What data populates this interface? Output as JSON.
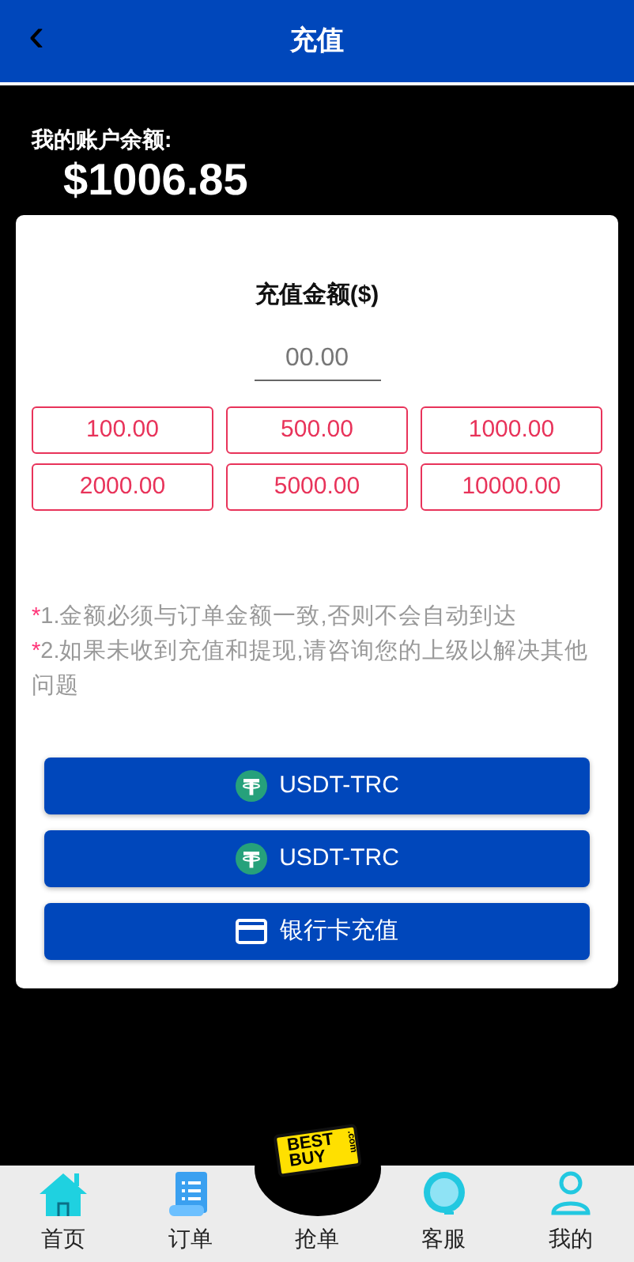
{
  "header": {
    "back": "‹",
    "title": "充值"
  },
  "balance": {
    "label": "我的账户余额:",
    "amount": "$1006.85"
  },
  "recharge": {
    "title": "充值金额($)",
    "amount_field": {
      "placeholder": "00.00"
    },
    "presets": [
      "100.00",
      "500.00",
      "1000.00",
      "2000.00",
      "5000.00",
      "10000.00"
    ],
    "notes": [
      {
        "mark": "*",
        "text": "1.金额必须与订单金额一致,否则不会自动到达"
      },
      {
        "mark": "*",
        "text": "2.如果未收到充值和提现,请咨询您的上级以解决其他问题"
      }
    ],
    "methods": [
      {
        "kind": "usdt",
        "label": "USDT-TRC"
      },
      {
        "kind": "usdt",
        "label": "USDT-TRC"
      },
      {
        "kind": "card",
        "label": "银行卡充值"
      }
    ]
  },
  "tabbar": [
    {
      "kind": "home",
      "label": "首页",
      "selected": false
    },
    {
      "kind": "orders",
      "label": "订单",
      "selected": false
    },
    {
      "kind": "logo",
      "label": "抢单",
      "logo_lines": [
        "BEST",
        "BUY"
      ],
      "logo_suffix": ".com",
      "selected": false
    },
    {
      "kind": "service",
      "label": "客服",
      "selected": false
    },
    {
      "kind": "profile",
      "label": "我的",
      "selected": false
    }
  ]
}
